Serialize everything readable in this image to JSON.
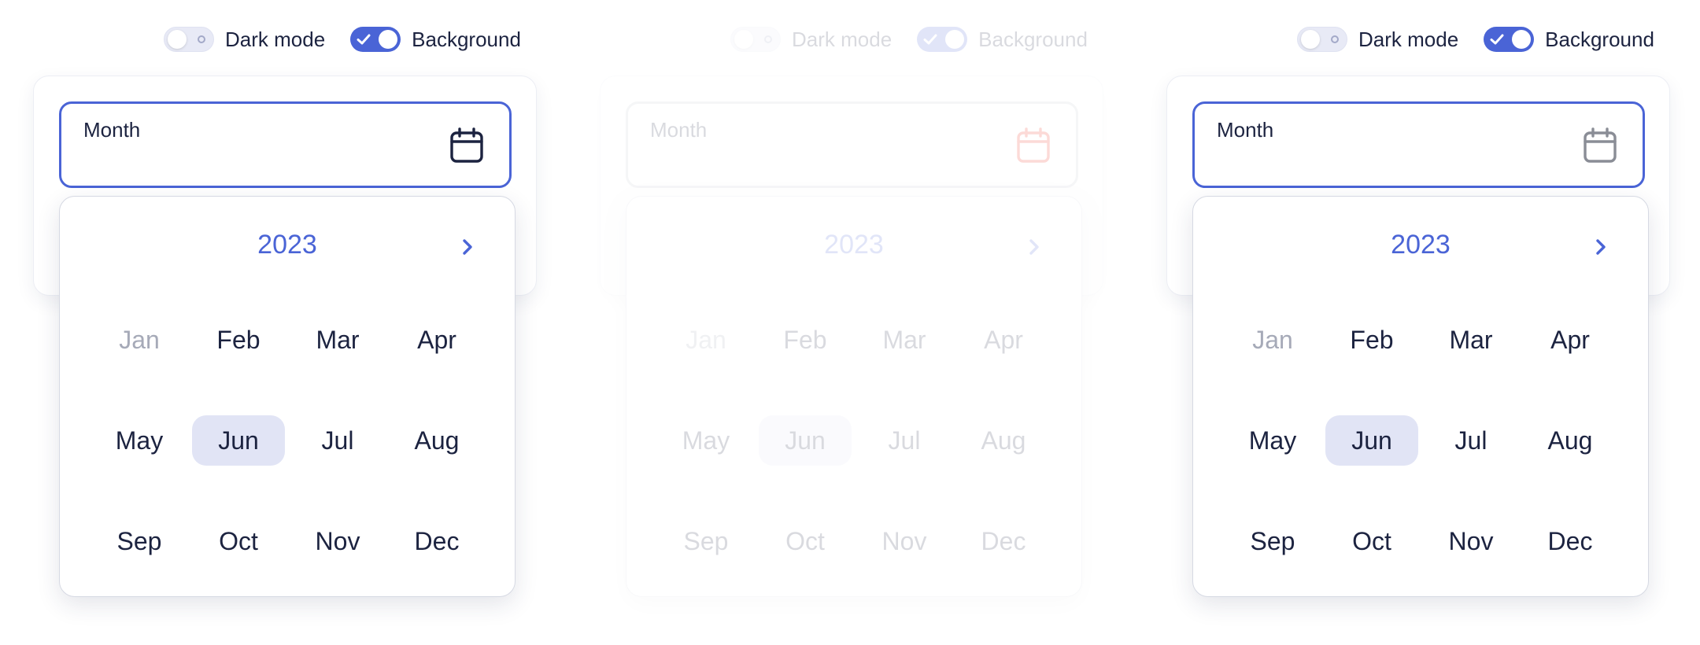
{
  "colors": {
    "accent": "#4a64d6",
    "text": "#1c2340",
    "disabled": "#a6aab8",
    "selected_bg": "#e1e4f5",
    "icon_dark": "#1c2340",
    "icon_red": "#f0220f",
    "icon_gray": "#8a8d96"
  },
  "panels": [
    {
      "toggles": [
        {
          "label": "Dark mode",
          "state": "off"
        },
        {
          "label": "Background",
          "state": "on"
        }
      ],
      "field_label": "Month",
      "calendar_icon_color": "dark",
      "year": "2023",
      "months": [
        "Jan",
        "Feb",
        "Mar",
        "Apr",
        "May",
        "Jun",
        "Jul",
        "Aug",
        "Sep",
        "Oct",
        "Nov",
        "Dec"
      ],
      "disabled_month": "Jan",
      "selected_month": "Jun"
    },
    {
      "toggles": [
        {
          "label": "Dark mode",
          "state": "off"
        },
        {
          "label": "Background",
          "state": "on"
        }
      ],
      "field_label": "Month",
      "calendar_icon_color": "red",
      "year": "2023",
      "months": [
        "Jan",
        "Feb",
        "Mar",
        "Apr",
        "May",
        "Jun",
        "Jul",
        "Aug",
        "Sep",
        "Oct",
        "Nov",
        "Dec"
      ],
      "disabled_month": "Jan",
      "selected_month": "Jun"
    },
    {
      "toggles": [
        {
          "label": "Dark mode",
          "state": "off"
        },
        {
          "label": "Background",
          "state": "on"
        }
      ],
      "field_label": "Month",
      "calendar_icon_color": "gray",
      "year": "2023",
      "months": [
        "Jan",
        "Feb",
        "Mar",
        "Apr",
        "May",
        "Jun",
        "Jul",
        "Aug",
        "Sep",
        "Oct",
        "Nov",
        "Dec"
      ],
      "disabled_month": "Jan",
      "selected_month": "Jun"
    }
  ],
  "icons": {
    "calendar": "calendar-icon",
    "next": "chevron-right-icon",
    "check": "check-icon"
  }
}
